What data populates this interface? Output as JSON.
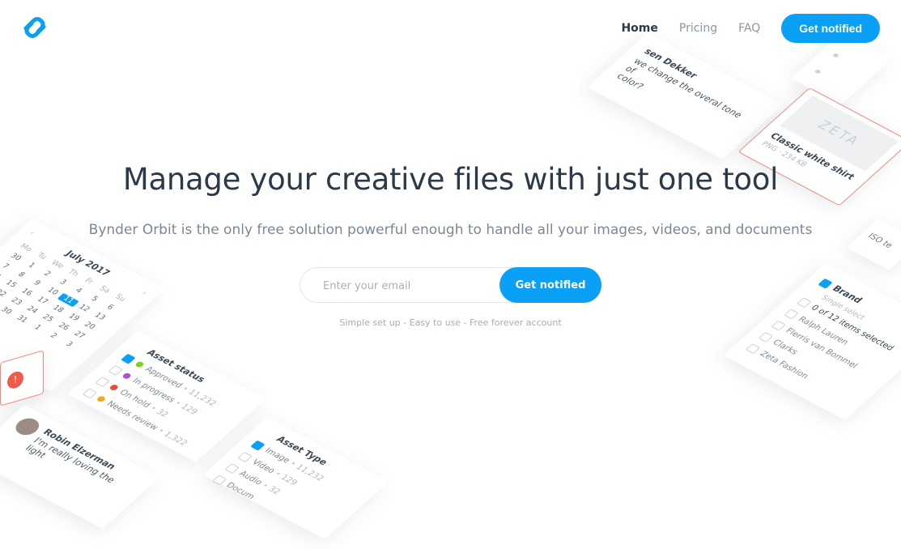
{
  "nav": {
    "items": [
      {
        "label": "Home",
        "active": true
      },
      {
        "label": "Pricing",
        "active": false
      },
      {
        "label": "FAQ",
        "active": false
      }
    ],
    "cta_label": "Get notified"
  },
  "hero": {
    "title": "Manage your creative files with just one tool",
    "subtitle": "Bynder Orbit is the only free solution powerful enough to handle all your images, videos, and documents",
    "email_placeholder": "Enter your email",
    "cta_label": "Get notified",
    "tagline": "Simple set up - Easy to use - Free forever account"
  },
  "cards": {
    "comment_top": {
      "author": "sen Dekker",
      "line1": "we change the overal tone of",
      "line2": "color?"
    },
    "asset_top": {
      "name": "Classic white shirt",
      "meta": "PNG · 234 KB",
      "image_text": "ZETA"
    },
    "calendar": {
      "month": "July 2017",
      "weekdays": [
        "Mo",
        "Tu",
        "We",
        "Th",
        "Fr",
        "Sa",
        "Su"
      ],
      "days": [
        "30",
        "1",
        "2",
        "3",
        "4",
        "5",
        "6",
        "7",
        "8",
        "9",
        "10",
        "11",
        "12",
        "13",
        "14",
        "15",
        "16",
        "17",
        "18",
        "19",
        "20",
        "21",
        "22",
        "23",
        "24",
        "25",
        "26",
        "27",
        "28",
        "29",
        "30",
        "31",
        "1",
        "2",
        "3"
      ],
      "selected": "11"
    },
    "asset_status": {
      "title": "Asset status",
      "items": [
        {
          "label": "Approved",
          "count": "11,232",
          "color": "#7ed321"
        },
        {
          "label": "In progress",
          "count": "129",
          "color": "#b44ce0"
        },
        {
          "label": "On hold",
          "count": "32",
          "color": "#e94e3c"
        },
        {
          "label": "Needs review",
          "count": "1,322",
          "color": "#f5a623"
        }
      ]
    },
    "comment_bottom": {
      "author": "Robin Elzerman",
      "text": "I'm really loving the light"
    },
    "asset_type": {
      "title": "Asset Type",
      "items": [
        {
          "label": "Image",
          "count": "11,232"
        },
        {
          "label": "Video",
          "count": "129"
        },
        {
          "label": "Audio",
          "count": "32"
        },
        {
          "label": "Docum",
          "count": ""
        }
      ]
    },
    "brand": {
      "title": "Brand",
      "subtitle": "Single select",
      "summary": "0 of 12 items selected",
      "items": [
        "Ralph Lauren",
        "Flerris van Bommel",
        "Clarks",
        "Zeta Fashion"
      ],
      "iso_label": "ISO te"
    }
  },
  "colors": {
    "accent": "#0aa0f5",
    "text": "#2b3a48",
    "muted": "#7b8794"
  }
}
